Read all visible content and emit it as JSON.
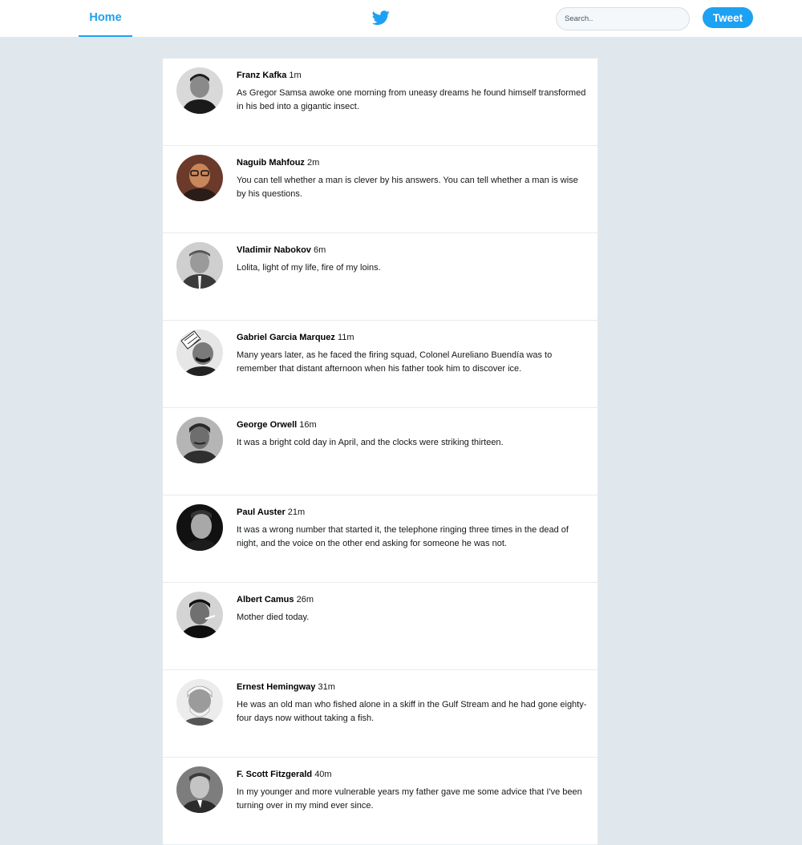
{
  "nav": {
    "home_label": "Home",
    "logo_icon": "twitter-bird-icon",
    "brand_color": "#1da1f2"
  },
  "search": {
    "placeholder": "Search..",
    "value": ""
  },
  "tweet_button": {
    "label": "Tweet"
  },
  "tweets": [
    {
      "author": "Franz Kafka",
      "time": "1m",
      "text": "As Gregor Samsa awoke one morning from uneasy dreams he found himself transformed in his bed into a gigantic insect."
    },
    {
      "author": "Naguib Mahfouz",
      "time": "2m",
      "text": "You can tell whether a man is clever by his answers. You can tell whether a man is wise by his questions."
    },
    {
      "author": "Vladimir Nabokov",
      "time": "6m",
      "text": "Lolita, light of my life, fire of my loins."
    },
    {
      "author": "Gabriel Garcia Marquez",
      "time": "11m",
      "text": "Many years later, as he faced the firing squad, Colonel Aureliano Buendía was to remember that distant afternoon when his father took him to discover ice."
    },
    {
      "author": "George Orwell",
      "time": "16m",
      "text": "It was a bright cold day in April, and the clocks were striking thirteen."
    },
    {
      "author": "Paul Auster",
      "time": "21m",
      "text": "It was a wrong number that started it, the telephone ringing three times in the dead of night, and the voice on the other end asking for someone he was not."
    },
    {
      "author": "Albert Camus",
      "time": "26m",
      "text": "Mother died today."
    },
    {
      "author": "Ernest Hemingway",
      "time": "31m",
      "text": "He was an old man who fished alone in a skiff in the Gulf Stream and he had gone eighty-four days now without taking a fish."
    },
    {
      "author": "F. Scott Fitzgerald",
      "time": "40m",
      "text": "In my younger and more vulnerable years my father gave me some advice that I've been turning over in my mind ever since."
    }
  ]
}
